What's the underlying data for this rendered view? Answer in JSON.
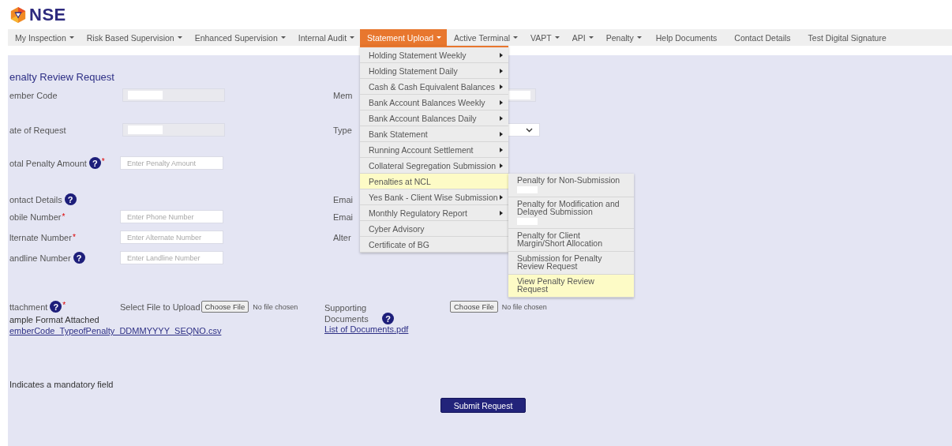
{
  "logo": {
    "text": "NSE"
  },
  "nav": [
    {
      "label": "My Inspection",
      "caret": true,
      "selected": false
    },
    {
      "label": "Risk Based Supervision",
      "caret": true,
      "selected": false
    },
    {
      "label": "Enhanced Supervision",
      "caret": true,
      "selected": false
    },
    {
      "label": "Internal Audit",
      "caret": true,
      "selected": false
    },
    {
      "label": "Statement Upload",
      "caret": true,
      "selected": true
    },
    {
      "label": "Active Terminal",
      "caret": true,
      "selected": false
    },
    {
      "label": "VAPT",
      "caret": true,
      "selected": false
    },
    {
      "label": "API",
      "caret": true,
      "selected": false
    },
    {
      "label": "Penalty",
      "caret": true,
      "selected": false
    },
    {
      "label": "Help Documents",
      "caret": false,
      "selected": false
    },
    {
      "label": "Contact Details",
      "caret": false,
      "selected": false
    },
    {
      "label": "Test Digital Signature",
      "caret": false,
      "selected": false
    }
  ],
  "menu": {
    "items": [
      {
        "label": "Holding Statement Weekly",
        "has_submenu": true,
        "selected": false
      },
      {
        "label": "Holding Statement Daily",
        "has_submenu": true,
        "selected": false
      },
      {
        "label": "Cash & Cash Equivalent Balances",
        "has_submenu": true,
        "selected": false
      },
      {
        "label": "Bank Account Balances Weekly",
        "has_submenu": true,
        "selected": false
      },
      {
        "label": "Bank Account Balances Daily",
        "has_submenu": true,
        "selected": false
      },
      {
        "label": "Bank Statement",
        "has_submenu": true,
        "selected": false
      },
      {
        "label": "Running Account Settlement",
        "has_submenu": true,
        "selected": false
      },
      {
        "label": "Collateral Segregation Submission",
        "has_submenu": true,
        "selected": false
      },
      {
        "label": "Penalties at NCL",
        "has_submenu": false,
        "selected": true
      },
      {
        "label": "Yes Bank - Client Wise Submission",
        "has_submenu": true,
        "selected": false
      },
      {
        "label": "Monthly Regulatory Report",
        "has_submenu": true,
        "selected": false
      },
      {
        "label": "Cyber Advisory",
        "has_submenu": false,
        "selected": false
      },
      {
        "label": "Certificate of BG",
        "has_submenu": false,
        "selected": false
      }
    ],
    "submenu": [
      {
        "label": "Penalty for Non-Submission",
        "redacted": true,
        "selected": false
      },
      {
        "label": "Penalty for Modification and Delayed Submission",
        "redacted": true,
        "selected": false
      },
      {
        "label": "Penalty for Client Margin/Short Allocation",
        "redacted": false,
        "selected": false
      },
      {
        "label": "Submission for Penalty Review Request",
        "redacted": false,
        "selected": false
      },
      {
        "label": "View Penalty Review Request",
        "redacted": false,
        "selected": true
      }
    ]
  },
  "form": {
    "title": "enalty Review Request",
    "rows": [
      {
        "label": "ember Code",
        "kind": "readonly",
        "right": {
          "label": "Mem",
          "kind": "readonly"
        }
      },
      {
        "label": "ate of Request",
        "kind": "readonly",
        "right": {
          "label": "Type",
          "kind": "select"
        }
      },
      {
        "label": "otal Penalty Amount",
        "help": "?",
        "required_mark": "*",
        "kind": "input",
        "placeholder": "Enter Penalty Amount"
      },
      {
        "label": "ontact Details",
        "help": "?",
        "kind": "none",
        "right": {
          "label": "Emai",
          "kind": "none"
        }
      },
      {
        "label": "obile Number",
        "required_mark": "*",
        "kind": "input",
        "placeholder": "Enter Phone Number",
        "right": {
          "label": "Emai",
          "kind": "none"
        }
      },
      {
        "label": "lternate Number",
        "required_mark": "*",
        "kind": "input",
        "placeholder": "Enter Alternate Number",
        "right": {
          "label": "Alter",
          "kind": "none"
        }
      },
      {
        "label": "andline Number",
        "help": "?",
        "kind": "input",
        "placeholder": "Enter Landline Number"
      }
    ],
    "attachment": {
      "label": "ttachment",
      "help": "?",
      "required_mark": "*",
      "upload_label": "Select File to Upload",
      "button": "Choose File",
      "file_status": "No file chosen",
      "sample_label": "ample Format Attached",
      "sample_link": "emberCode_TypeofPenalty_DDMMYYYY_SEQNO.csv"
    },
    "supporting": {
      "label": "Supporting Documents",
      "help": "?",
      "link": "List of Documents.pdf",
      "button": "Choose File",
      "file_status": "No file chosen"
    },
    "mandatory_note": "Indicates a mandatory field",
    "submit": "Submit Request"
  }
}
